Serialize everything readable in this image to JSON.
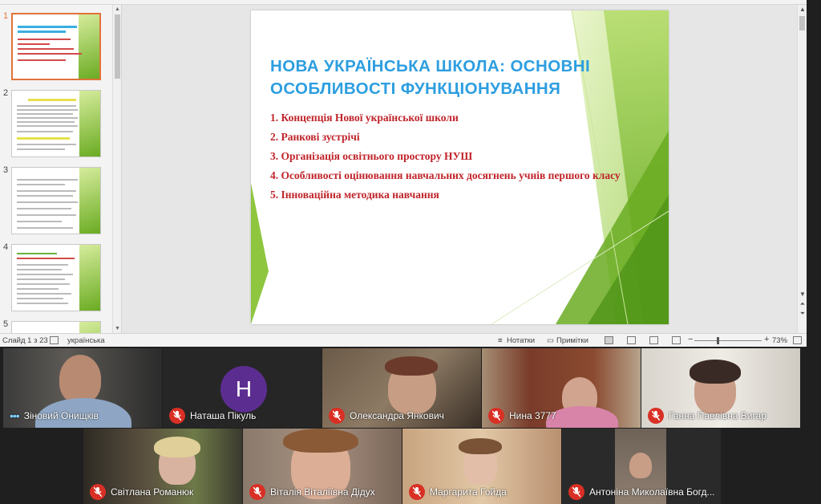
{
  "slide": {
    "title": "НОВА УКРАЇНСЬКА ШКОЛА: ОСНОВНІ ОСОБЛИВОСТІ ФУНКЦІОНУВАННЯ",
    "items": [
      "1. Концепція Нової української школи",
      "2. Ранкові зустрічі",
      "3. Організація освітнього простору НУШ",
      "4. Особливості оцінювання навчальних досягнень учнів першого класу",
      "5. Інноваційна методика навчання"
    ]
  },
  "thumbnails": [
    {
      "number": "1"
    },
    {
      "number": "2"
    },
    {
      "number": "3"
    },
    {
      "number": "4"
    },
    {
      "number": "5"
    }
  ],
  "status_bar": {
    "slide_counter": "Слайд 1 з 23",
    "language": "українська",
    "notes": "Нотатки",
    "comments": "Примітки",
    "zoom": "73%",
    "minus": "−",
    "plus": "+"
  },
  "participants": [
    {
      "name": "Зіновий Онищків",
      "muted": false
    },
    {
      "name": "Наташа Пікуль",
      "muted": true,
      "initial": "H"
    },
    {
      "name": "Олександра Янкович",
      "muted": true
    },
    {
      "name": "Нина 3777",
      "muted": true
    },
    {
      "name": "Ганна Павлівна Бигар",
      "muted": true
    },
    {
      "name": "Світлана Романюк",
      "muted": true
    },
    {
      "name": "Віталія Віталіївна Дідух",
      "muted": true
    },
    {
      "name": "Маргарита Гойда",
      "muted": true
    },
    {
      "name": "Антоніна Миколаївна Богд...",
      "muted": true
    }
  ],
  "colors": {
    "title_blue": "#2d9ee0",
    "list_red": "#c0242a",
    "slide_green": "#6aab22",
    "selected_thumb": "#e0733a",
    "mute_red": "#d93025",
    "avatar_purple": "#5c2d91"
  }
}
